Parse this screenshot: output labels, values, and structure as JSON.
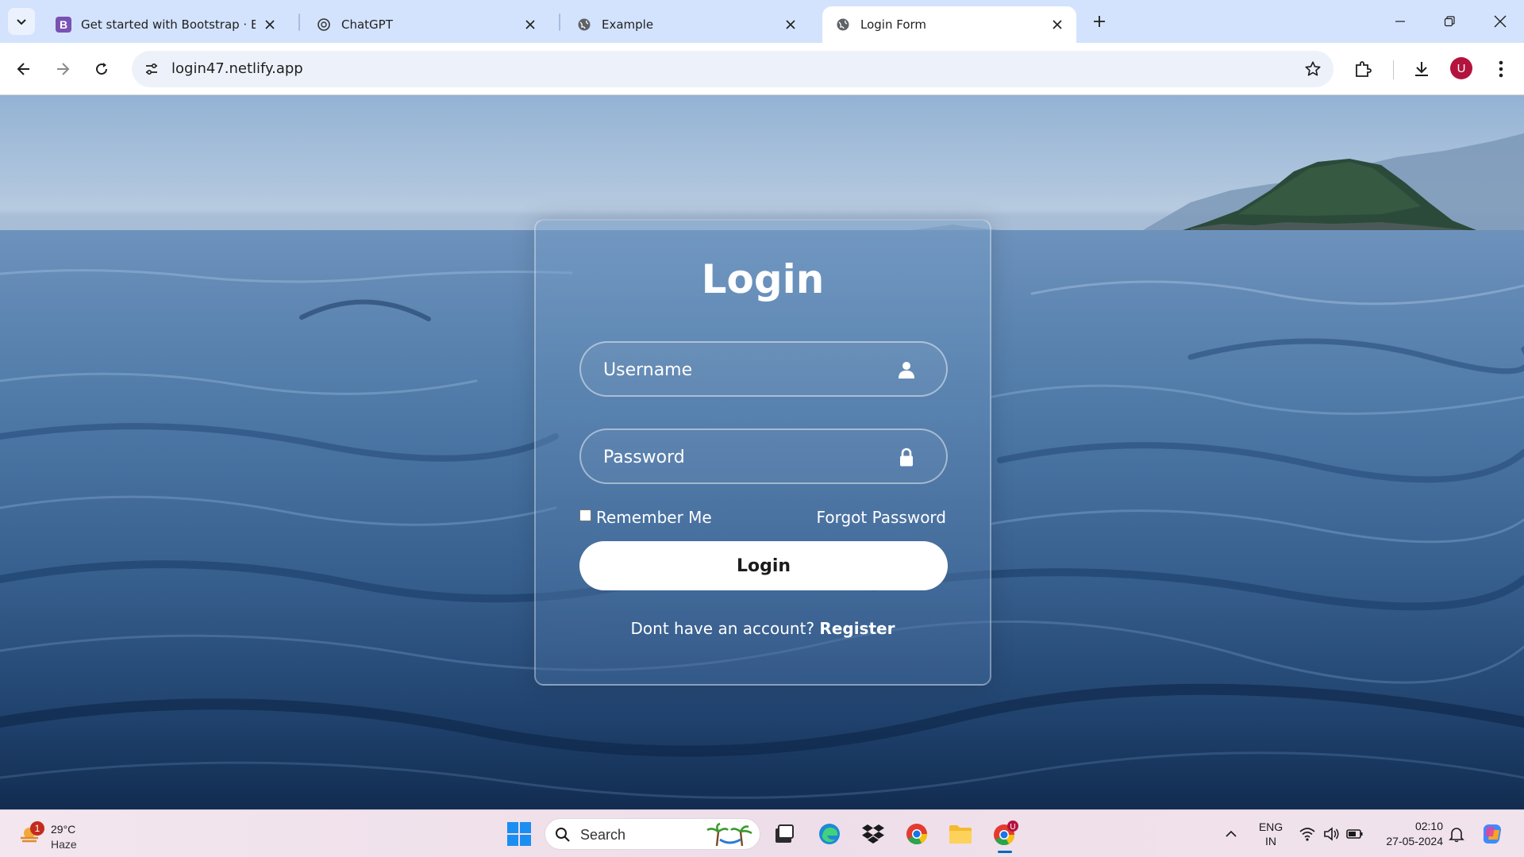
{
  "browser": {
    "tabs": [
      {
        "title": "Get started with Bootstrap · Bootstrap",
        "favicon": "bootstrap-icon",
        "active": false
      },
      {
        "title": "ChatGPT",
        "favicon": "chatgpt-icon",
        "active": false
      },
      {
        "title": "Example",
        "favicon": "globe-icon",
        "active": false
      },
      {
        "title": "Login Form",
        "favicon": "globe-icon",
        "active": true
      }
    ],
    "url": "login47.netlify.app",
    "profile_initial": "U",
    "accent_color": "#d3e3fd"
  },
  "login": {
    "title": "Login",
    "username_placeholder": "Username",
    "password_placeholder": "Password",
    "remember_label": "Remember Me",
    "forgot_label": "Forgot Password",
    "submit_label": "Login",
    "register_prompt": "Dont have an account?",
    "register_link": "Register"
  },
  "taskbar": {
    "weather": {
      "temp": "29°C",
      "condition": "Haze",
      "badge": "1"
    },
    "search_placeholder": "Search",
    "language": {
      "line1": "ENG",
      "line2": "IN"
    },
    "time": "02:10",
    "date": "27-05-2024",
    "chrome_badge": "U"
  }
}
